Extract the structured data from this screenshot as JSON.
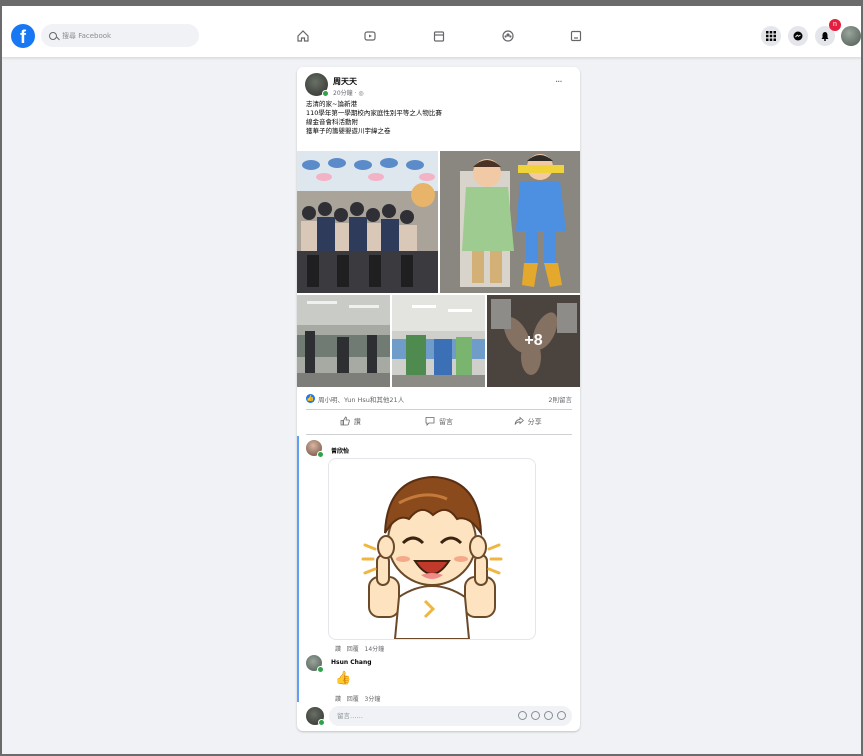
{
  "header": {
    "logo": "f",
    "search_placeholder": "搜尋 Facebook",
    "nav_icons": [
      "home-icon",
      "watch-icon",
      "marketplace-icon",
      "groups-icon",
      "gaming-icon"
    ],
    "right_icons": [
      "menu-grid-icon",
      "messenger-icon",
      "notifications-icon"
    ],
    "notification_count": "n"
  },
  "post": {
    "author": "周天天",
    "time": "20分鐘",
    "more": "···",
    "text_lines": [
      "志清的家~論新港",
      "110學年第一學期校內家庭性別平等之人物比賽",
      "線金音會科活動附",
      "獲華子的籌嬰嬰遊川宇緯之卷"
    ],
    "photo_more": "+8",
    "reactions_text": "周小明、Yun Hsu和其他21人",
    "comments_count": "2則留言",
    "actions": {
      "like": "讚",
      "comment": "留言",
      "share": "分享"
    }
  },
  "comments": [
    {
      "name": "曾欣怡",
      "meta": [
        "讚",
        "回覆",
        "14分鐘"
      ]
    },
    {
      "name": "Hsun Chang",
      "meta": [
        "讚",
        "回覆",
        "3分鐘"
      ]
    }
  ],
  "write_comment": {
    "placeholder": "留言……"
  },
  "colors": {
    "brand": "#1877f2",
    "background": "#f0f2f5",
    "badge": "#e41e3f"
  }
}
